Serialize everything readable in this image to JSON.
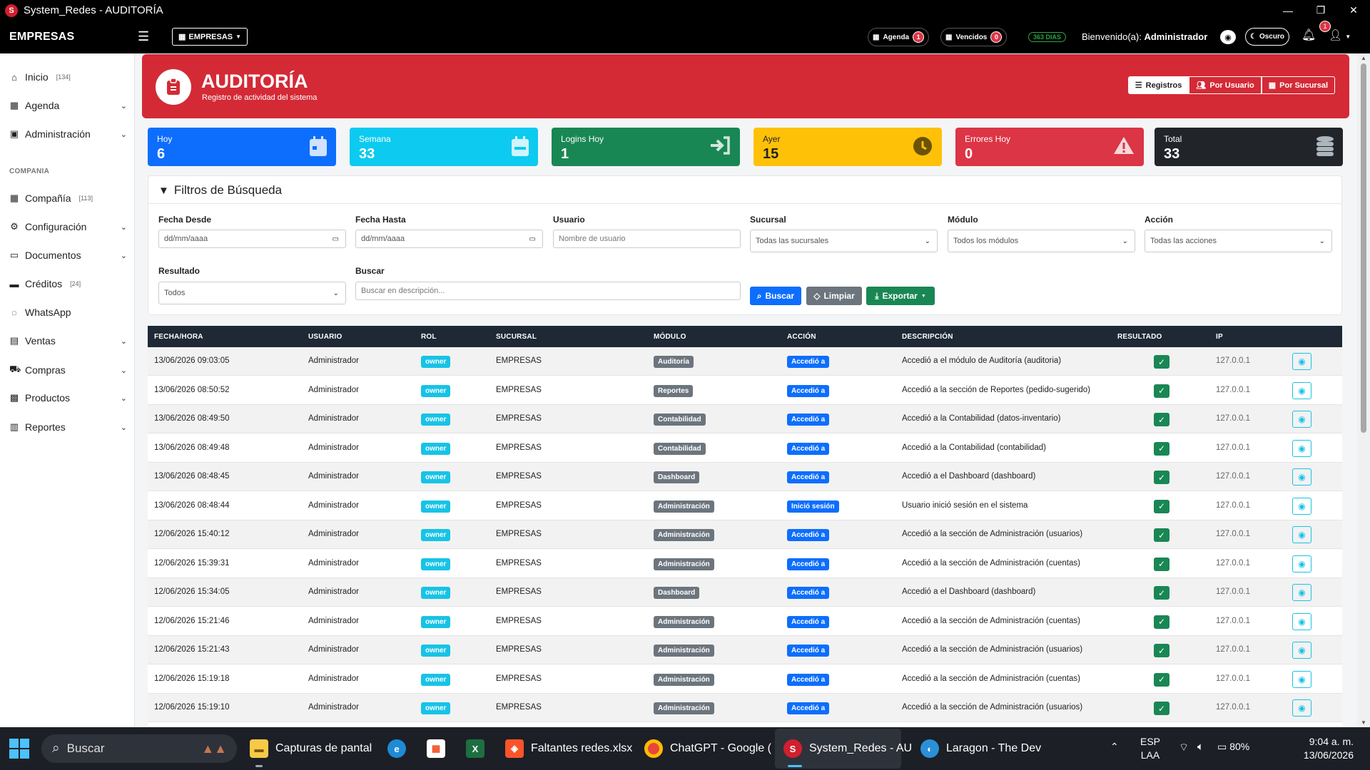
{
  "window": {
    "title": "System_Redes - AUDITORÍA"
  },
  "navbar": {
    "brand": "EMPRESAS",
    "company_dropdown": "EMPRESAS",
    "agenda_label": "Agenda",
    "agenda_count": "1",
    "vencidos_label": "Vencidos",
    "vencidos_count": "0",
    "days": "363 DIAS",
    "welcome_prefix": "Bienvenido(a):",
    "welcome_user": "Administrador",
    "dark_label": "Oscuro",
    "notif_count": "1"
  },
  "sidebar": {
    "items": [
      {
        "label": "Inicio",
        "badge": "[134]"
      },
      {
        "label": "Agenda",
        "badge": ""
      },
      {
        "label": "Administración",
        "badge": ""
      },
      {
        "label": "Compañía",
        "badge": "[113]"
      },
      {
        "label": "Configuración",
        "badge": ""
      },
      {
        "label": "Documentos",
        "badge": ""
      },
      {
        "label": "Créditos",
        "badge": "[24]"
      },
      {
        "label": "WhatsApp",
        "badge": ""
      },
      {
        "label": "Ventas",
        "badge": ""
      },
      {
        "label": "Compras",
        "badge": ""
      },
      {
        "label": "Productos",
        "badge": ""
      },
      {
        "label": "Reportes",
        "badge": ""
      }
    ],
    "section": "COMPANIA"
  },
  "header": {
    "title": "AUDITORÍA",
    "subtitle": "Registro de actividad del sistema",
    "btn_registros": "Registros",
    "btn_usuario": "Por Usuario",
    "btn_sucursal": "Por Sucursal"
  },
  "stats": [
    {
      "label": "Hoy",
      "value": "6",
      "color": "#0d6efd"
    },
    {
      "label": "Semana",
      "value": "33",
      "color": "#0dcaf0"
    },
    {
      "label": "Logins Hoy",
      "value": "1",
      "color": "#198754"
    },
    {
      "label": "Ayer",
      "value": "15",
      "color": "#ffc107"
    },
    {
      "label": "Errores Hoy",
      "value": "0",
      "color": "#dc3545"
    },
    {
      "label": "Total",
      "value": "33",
      "color": "#212529"
    }
  ],
  "filters": {
    "title": "Filtros de Búsqueda",
    "fecha_desde": {
      "label": "Fecha Desde",
      "value": "dd/mm/aaaa"
    },
    "fecha_hasta": {
      "label": "Fecha Hasta",
      "value": "dd/mm/aaaa"
    },
    "usuario": {
      "label": "Usuario",
      "placeholder": "Nombre de usuario"
    },
    "sucursal": {
      "label": "Sucursal",
      "value": "Todas las sucursales"
    },
    "modulo": {
      "label": "Módulo",
      "value": "Todos los módulos"
    },
    "accion": {
      "label": "Acción",
      "value": "Todas las acciones"
    },
    "resultado": {
      "label": "Resultado",
      "value": "Todos"
    },
    "buscar": {
      "label": "Buscar",
      "placeholder": "Buscar en descripción..."
    },
    "btn_buscar": "Buscar",
    "btn_limpiar": "Limpiar",
    "btn_exportar": "Exportar"
  },
  "table": {
    "headers": [
      "FECHA/HORA",
      "USUARIO",
      "ROL",
      "SUCURSAL",
      "MÓDULO",
      "ACCIÓN",
      "DESCRIPCIÓN",
      "RESULTADO",
      "IP"
    ],
    "rows": [
      {
        "fecha": "13/06/2026 09:03:05",
        "usuario": "Administrador",
        "rol": "owner",
        "sucursal": "EMPRESAS",
        "modulo": "Auditoría",
        "accion": "Accedió a",
        "descripcion": "Accedió a el módulo de Auditoría (auditoria)",
        "ip": "127.0.0.1"
      },
      {
        "fecha": "13/06/2026 08:50:52",
        "usuario": "Administrador",
        "rol": "owner",
        "sucursal": "EMPRESAS",
        "modulo": "Reportes",
        "accion": "Accedió a",
        "descripcion": "Accedió a la sección de Reportes (pedido-sugerido)",
        "ip": "127.0.0.1"
      },
      {
        "fecha": "13/06/2026 08:49:50",
        "usuario": "Administrador",
        "rol": "owner",
        "sucursal": "EMPRESAS",
        "modulo": "Contabilidad",
        "accion": "Accedió a",
        "descripcion": "Accedió a la Contabilidad (datos-inventario)",
        "ip": "127.0.0.1"
      },
      {
        "fecha": "13/06/2026 08:49:48",
        "usuario": "Administrador",
        "rol": "owner",
        "sucursal": "EMPRESAS",
        "modulo": "Contabilidad",
        "accion": "Accedió a",
        "descripcion": "Accedió a la Contabilidad (contabilidad)",
        "ip": "127.0.0.1"
      },
      {
        "fecha": "13/06/2026 08:48:45",
        "usuario": "Administrador",
        "rol": "owner",
        "sucursal": "EMPRESAS",
        "modulo": "Dashboard",
        "accion": "Accedió a",
        "descripcion": "Accedió a el Dashboard (dashboard)",
        "ip": "127.0.0.1"
      },
      {
        "fecha": "13/06/2026 08:48:44",
        "usuario": "Administrador",
        "rol": "owner",
        "sucursal": "EMPRESAS",
        "modulo": "Administración",
        "accion": "Inició sesión",
        "descripcion": "Usuario inició sesión en el sistema",
        "ip": "127.0.0.1"
      },
      {
        "fecha": "12/06/2026 15:40:12",
        "usuario": "Administrador",
        "rol": "owner",
        "sucursal": "EMPRESAS",
        "modulo": "Administración",
        "accion": "Accedió a",
        "descripcion": "Accedió a la sección de Administración (usuarios)",
        "ip": "127.0.0.1"
      },
      {
        "fecha": "12/06/2026 15:39:31",
        "usuario": "Administrador",
        "rol": "owner",
        "sucursal": "EMPRESAS",
        "modulo": "Administración",
        "accion": "Accedió a",
        "descripcion": "Accedió a la sección de Administración (cuentas)",
        "ip": "127.0.0.1"
      },
      {
        "fecha": "12/06/2026 15:34:05",
        "usuario": "Administrador",
        "rol": "owner",
        "sucursal": "EMPRESAS",
        "modulo": "Dashboard",
        "accion": "Accedió a",
        "descripcion": "Accedió a el Dashboard (dashboard)",
        "ip": "127.0.0.1"
      },
      {
        "fecha": "12/06/2026 15:21:46",
        "usuario": "Administrador",
        "rol": "owner",
        "sucursal": "EMPRESAS",
        "modulo": "Administración",
        "accion": "Accedió a",
        "descripcion": "Accedió a la sección de Administración (cuentas)",
        "ip": "127.0.0.1"
      },
      {
        "fecha": "12/06/2026 15:21:43",
        "usuario": "Administrador",
        "rol": "owner",
        "sucursal": "EMPRESAS",
        "modulo": "Administración",
        "accion": "Accedió a",
        "descripcion": "Accedió a la sección de Administración (usuarios)",
        "ip": "127.0.0.1"
      },
      {
        "fecha": "12/06/2026 15:19:18",
        "usuario": "Administrador",
        "rol": "owner",
        "sucursal": "EMPRESAS",
        "modulo": "Administración",
        "accion": "Accedió a",
        "descripcion": "Accedió a la sección de Administración (cuentas)",
        "ip": "127.0.0.1"
      },
      {
        "fecha": "12/06/2026 15:19:10",
        "usuario": "Administrador",
        "rol": "owner",
        "sucursal": "EMPRESAS",
        "modulo": "Administración",
        "accion": "Accedió a",
        "descripcion": "Accedió a la sección de Administración (usuarios)",
        "ip": "127.0.0.1"
      }
    ]
  },
  "taskbar": {
    "search": "Buscar",
    "items": [
      "Capturas de pantal",
      "Faltantes redes.xlsx",
      "ChatGPT - Google (",
      "System_Redes - AU",
      "Laragon - The Dev"
    ],
    "lang1": "ESP",
    "lang2": "LAA",
    "battery": "80%",
    "time": "9:04 a. m.",
    "date": "13/06/2026"
  }
}
